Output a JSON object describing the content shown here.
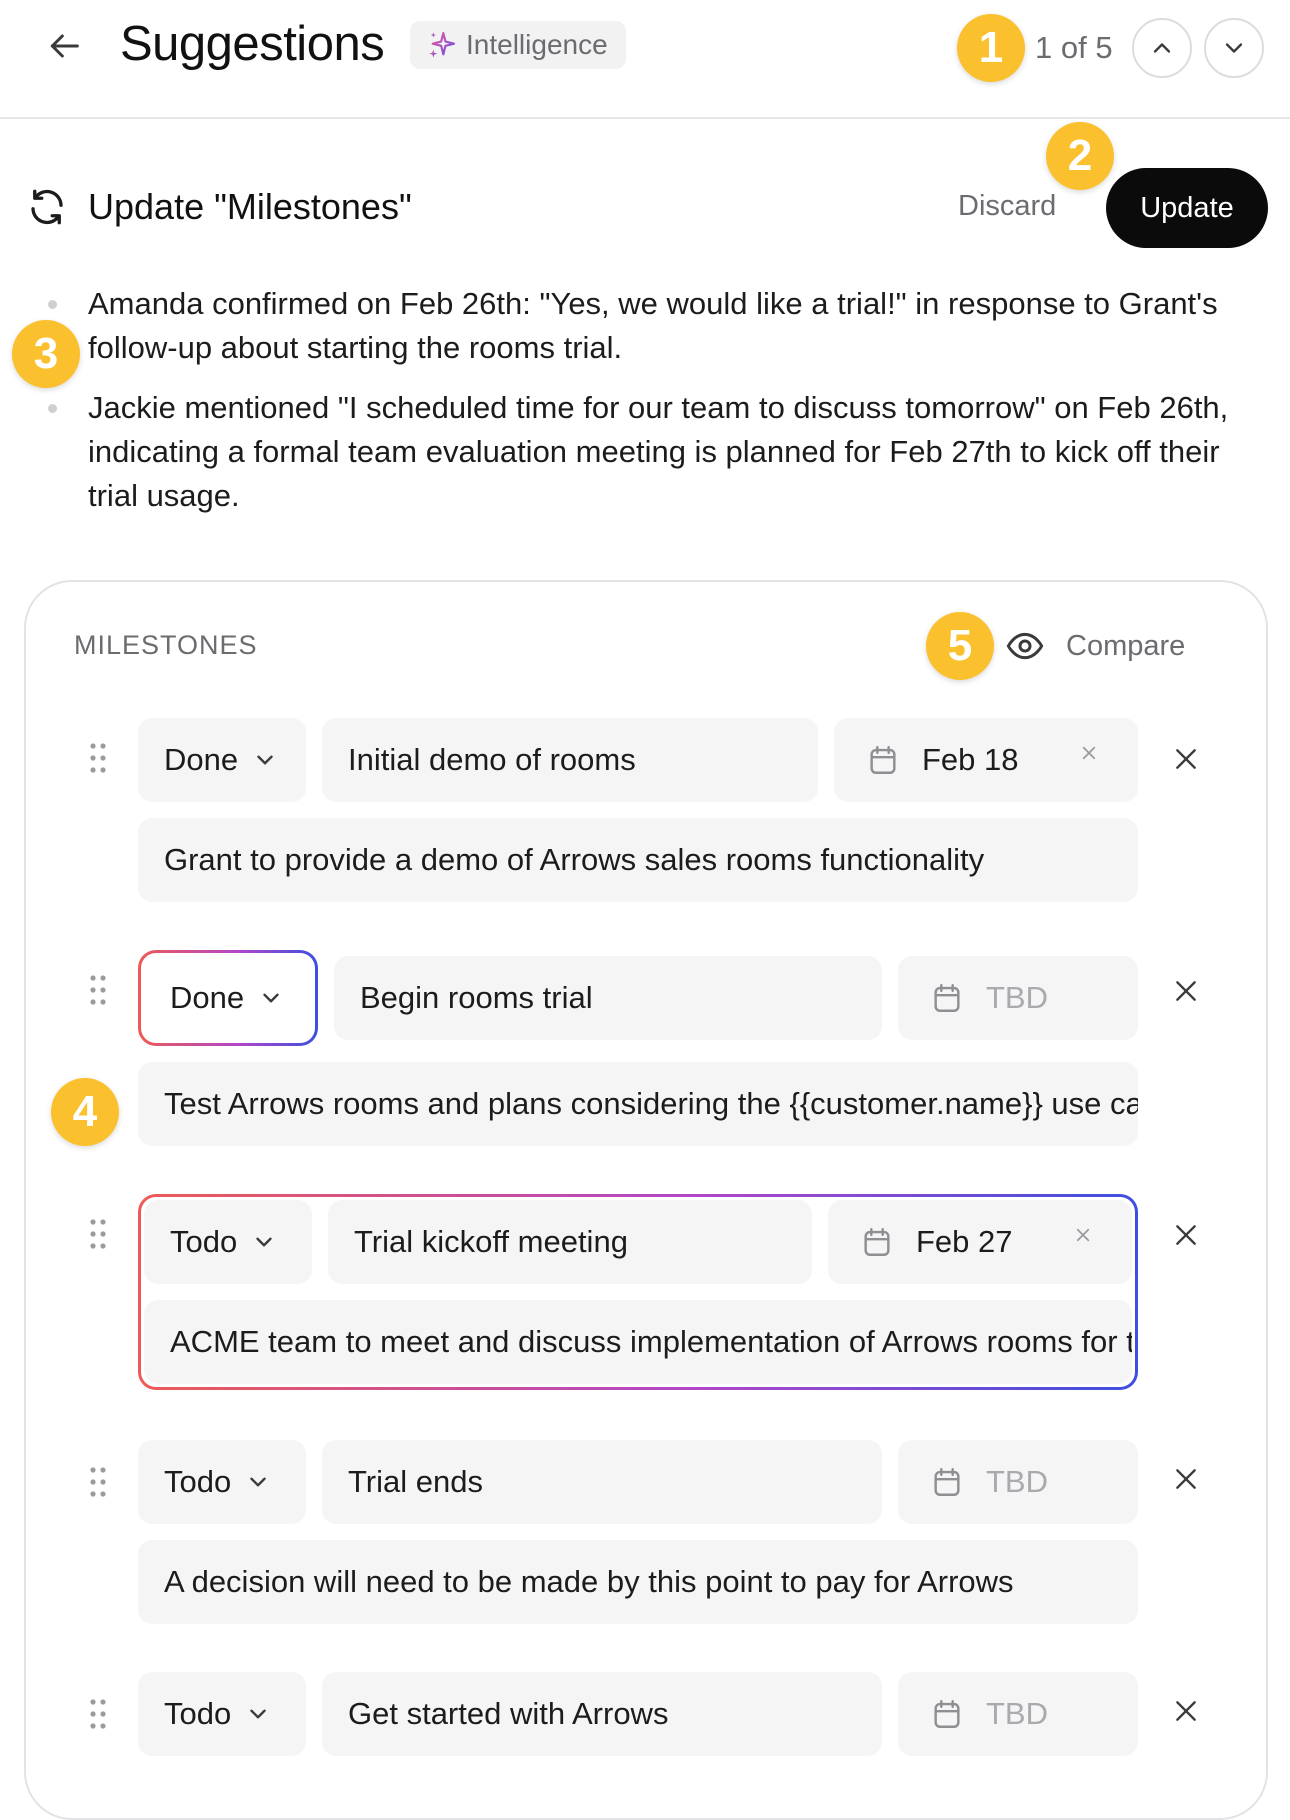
{
  "header": {
    "title": "Suggestions",
    "badge_label": "Intelligence",
    "counter": "1 of 5"
  },
  "markers": [
    "1",
    "2",
    "3",
    "4",
    "5"
  ],
  "suggestion": {
    "title": "Update \"Milestones\"",
    "discard_label": "Discard",
    "update_label": "Update",
    "bullets": [
      "Amanda confirmed on Feb 26th: \"Yes, we would like a trial!\" in response to Grant's follow-up about starting the rooms trial.",
      "Jackie mentioned \"I scheduled time for our team to discuss tomorrow\" on Feb 26th, indicating a formal team evaluation meeting is planned for Feb 27th to kick off their trial usage."
    ]
  },
  "milestones": {
    "section_label": "MILESTONES",
    "compare_label": "Compare",
    "items": [
      {
        "status": "Done",
        "title": "Initial demo of rooms",
        "date": "Feb 18",
        "description": "Grant to provide a demo of Arrows sales rooms functionality"
      },
      {
        "status": "Done",
        "title": "Begin rooms trial",
        "date": "TBD",
        "description": "Test Arrows rooms and plans considering the {{customer.name}} use case"
      },
      {
        "status": "Todo",
        "title": "Trial kickoff meeting",
        "date": "Feb 27",
        "description": "ACME team to meet and discuss implementation of Arrows rooms for their trial"
      },
      {
        "status": "Todo",
        "title": "Trial ends",
        "date": "TBD",
        "description": "A decision will need to be made by this point to pay for Arrows"
      },
      {
        "status": "Todo",
        "title": "Get started with Arrows",
        "date": "TBD",
        "description": ""
      }
    ]
  },
  "colors": {
    "marker": "#fbc02d",
    "primary_button": "#0b0b0b",
    "gradient_start": "#ec5b56",
    "gradient_end": "#3d4fe0"
  }
}
